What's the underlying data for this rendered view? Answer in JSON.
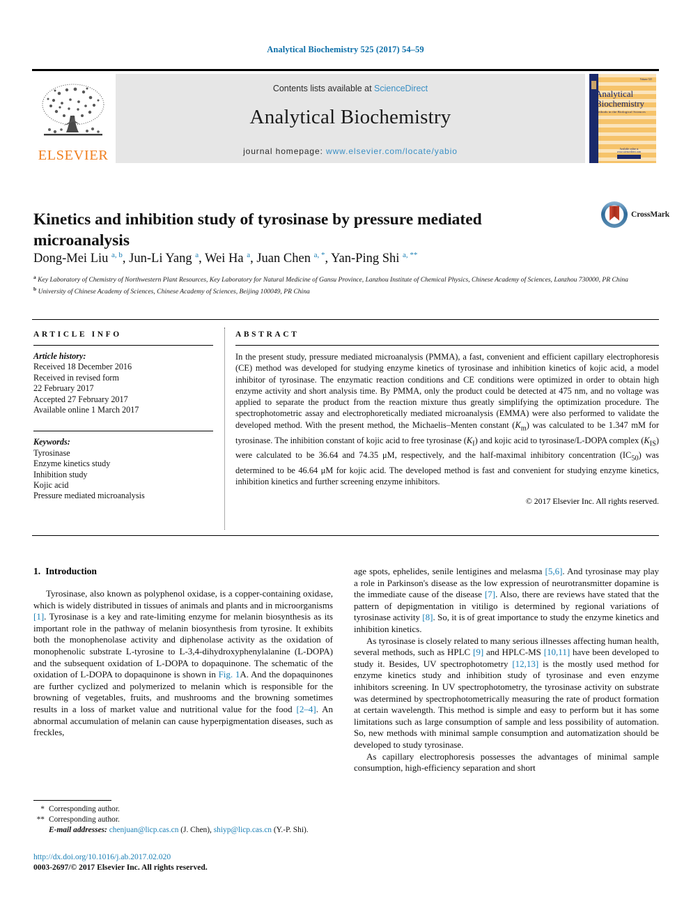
{
  "running_head": "Analytical Biochemistry 525 (2017) 54–59",
  "masthead": {
    "publisher_name": "ELSEVIER",
    "contents_prefix": "Contents lists available at ",
    "contents_link": "ScienceDirect",
    "journal_name": "Analytical Biochemistry",
    "homepage_prefix": "journal homepage: ",
    "homepage_url": "www.elsevier.com/locate/yabio",
    "cover": {
      "title": "Analytical Biochemistry",
      "subtitle": "Methods in the Biological Sciences",
      "issue_code": "Volume 525",
      "footer": "Available online at www.sciencedirect.com"
    }
  },
  "article": {
    "title": "Kinetics and inhibition study of tyrosinase by pressure mediated microanalysis",
    "crossmark_label": "CrossMark",
    "authors_html": "Dong-Mei Liu <sup>a, b</sup>, Jun-Li Yang <sup>a</sup>, Wei Ha <sup>a</sup>, Juan Chen <sup>a, *</sup>, Yan-Ping Shi <sup>a, **</sup>",
    "affiliation_a": "Key Laboratory of Chemistry of Northwestern Plant Resources, Key Laboratory for Natural Medicine of Gansu Province, Lanzhou Institute of Chemical Physics, Chinese Academy of Sciences, Lanzhou 730000, PR China",
    "affiliation_b": "University of Chinese Academy of Sciences, Chinese Academy of Sciences, Beijing 100049, PR China"
  },
  "article_info": {
    "heading": "ARTICLE INFO",
    "history_label": "Article history:",
    "history": [
      "Received 18 December 2016",
      "Received in revised form",
      "22 February 2017",
      "Accepted 27 February 2017",
      "Available online 1 March 2017"
    ],
    "keywords_label": "Keywords:",
    "keywords": [
      "Tyrosinase",
      "Enzyme kinetics study",
      "Inhibition study",
      "Kojic acid",
      "Pressure mediated microanalysis"
    ]
  },
  "abstract": {
    "heading": "ABSTRACT",
    "text": "In the present study, pressure mediated microanalysis (PMMA), a fast, convenient and efficient capillary electrophoresis (CE) method was developed for studying enzyme kinetics of tyrosinase and inhibition kinetics of kojic acid, a model inhibitor of tyrosinase. The enzymatic reaction conditions and CE conditions were optimized in order to obtain high enzyme activity and short analysis time. By PMMA, only the product could be detected at 475 nm, and no voltage was applied to separate the product from the reaction mixture thus greatly simplifying the optimization procedure. The spectrophotometric assay and electrophoretically mediated microanalysis (EMMA) were also performed to validate the developed method. With the present method, the Michaelis–Menten constant (Km) was calculated to be 1.347 mM for tyrosinase. The inhibition constant of kojic acid to free tyrosinase (KI) and kojic acid to tyrosinase/L-DOPA complex (KIS) were calculated to be 36.64 and 74.35 μM, respectively, and the half-maximal inhibitory concentration (IC50) was determined to be 46.64 μM for kojic acid. The developed method is fast and convenient for studying enzyme kinetics, inhibition kinetics and further screening enzyme inhibitors.",
    "copyright": "© 2017 Elsevier Inc. All rights reserved."
  },
  "sections": {
    "intro_number": "1.",
    "intro_title": "Introduction"
  },
  "body": {
    "left_p1": "Tyrosinase, also known as polyphenol oxidase, is a copper-containing oxidase, which is widely distributed in tissues of animals and plants and in microorganisms [1]. Tyrosinase is a key and rate-limiting enzyme for melanin biosynthesis as its important role in the pathway of melanin biosynthesis from tyrosine. It exhibits both the monophenolase activity and diphenolase activity as the oxidation of monophenolic substrate L-tyrosine to L-3,4-dihydroxyphenylalanine (L-DOPA) and the subsequent oxidation of L-DOPA to dopaquinone. The schematic of the oxidation of L-DOPA to dopaquinone is shown in Fig. 1A. And the dopaquinones are further cyclized and polymerized to melanin which is responsible for the browning of vegetables, fruits, and mushrooms and the browning sometimes results in a loss of market value and nutritional value for the food [2–4]. An abnormal accumulation of melanin can cause hyperpigmentation diseases, such as freckles,",
    "right_p1": "age spots, ephelides, senile lentigines and melasma [5,6]. And tyrosinase may play a role in Parkinson's disease as the low expression of neurotransmitter dopamine is the immediate cause of the disease [7]. Also, there are reviews have stated that the pattern of depigmentation in vitiligo is determined by regional variations of tyrosinase activity [8]. So, it is of great importance to study the enzyme kinetics and inhibition kinetics.",
    "right_p2": "As tyrosinase is closely related to many serious illnesses affecting human health, several methods, such as HPLC [9] and HPLC-MS [10,11] have been developed to study it. Besides, UV spectrophotometry [12,13] is the mostly used method for enzyme kinetics study and inhibition study of tyrosinase and even enzyme inhibitors screening. In UV spectrophotometry, the tyrosinase activity on substrate was determined by spectrophotometrically measuring the rate of product formation at certain wavelength. This method is simple and easy to perform but it has some limitations such as large consumption of sample and less possibility of automation. So, new methods with minimal sample consumption and automatization should be developed to study tyrosinase.",
    "right_p3": "As capillary electrophoresis possesses the advantages of minimal sample consumption, high-efficiency separation and short"
  },
  "footnotes": {
    "mark_1": "*",
    "text_1": "Corresponding author.",
    "mark_2": "**",
    "text_2": "Corresponding author.",
    "email_label": "E-mail addresses:",
    "email_1": "chenjuan@licp.cas.cn",
    "email_1_who": "(J. Chen),",
    "email_2": "shiyp@licp.cas.cn",
    "email_2_who": "(Y.-P. Shi)."
  },
  "doi": {
    "url": "http://dx.doi.org/10.1016/j.ab.2017.02.020",
    "issn_line": "0003-2697/© 2017 Elsevier Inc. All rights reserved."
  },
  "colors": {
    "link_blue": "#1a7fb5",
    "header_blue": "#0b6ea8",
    "sciencedirect_blue": "#3a8fc4",
    "elsevier_orange": "#f08020",
    "band_gray": "#e6e6e6",
    "cover_amber": "#f6c36a",
    "cover_navy": "#17256b",
    "crossmark_red": "#b5311f"
  }
}
